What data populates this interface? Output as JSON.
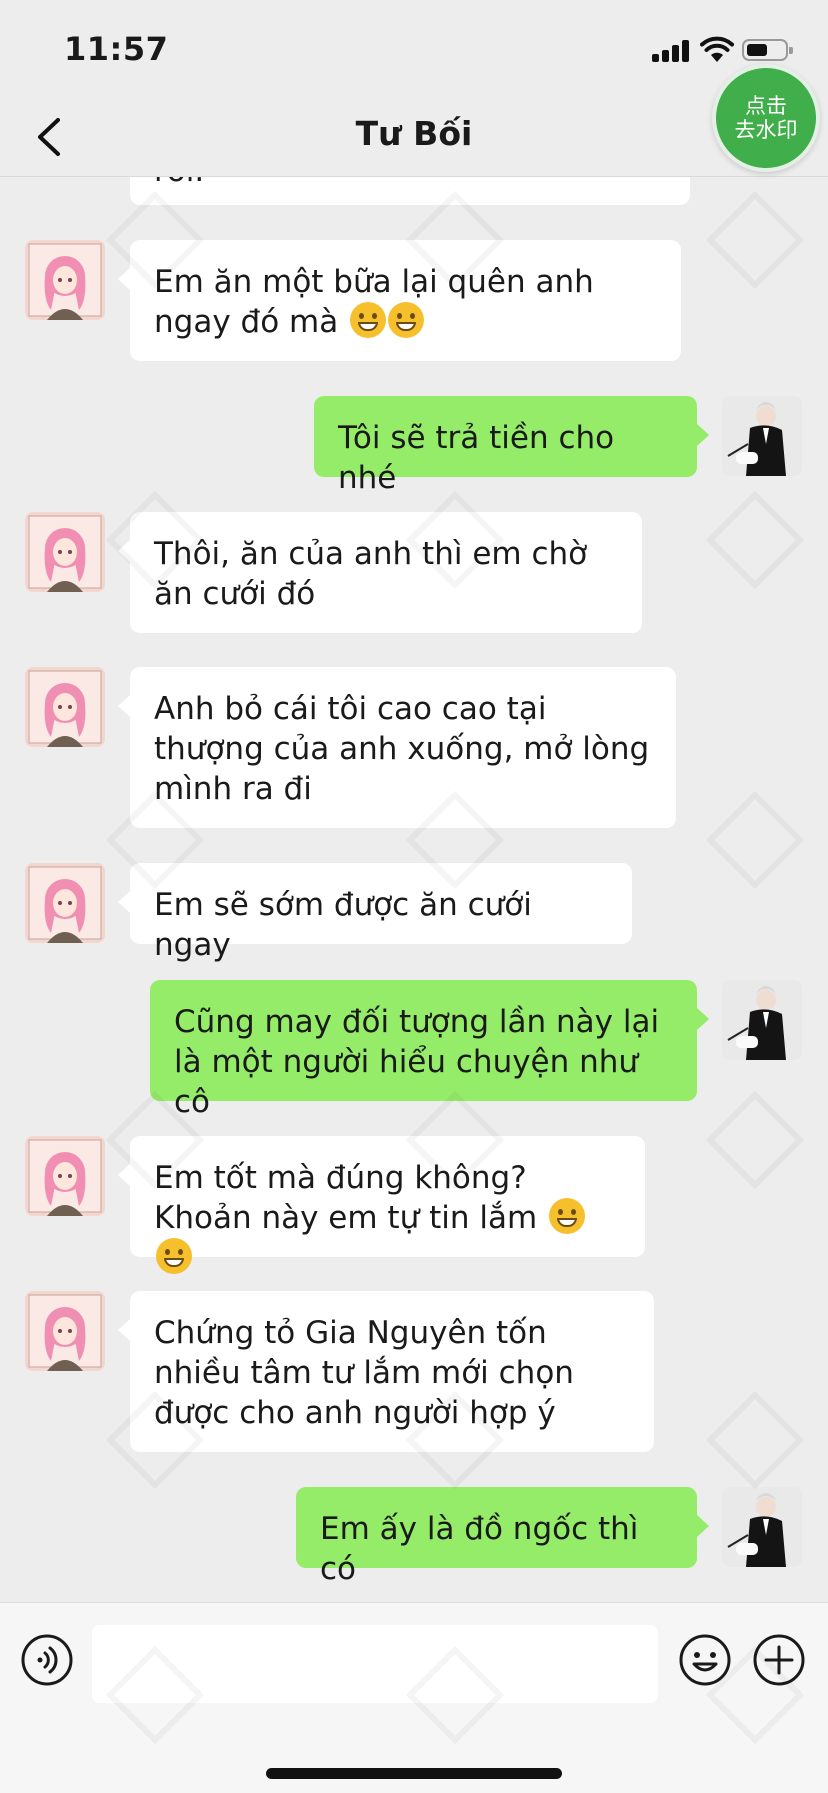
{
  "status_bar": {
    "time": "11:57"
  },
  "header": {
    "title": "Tư Bối",
    "watermark_badge": {
      "line1": "点击",
      "line2": "去水印"
    }
  },
  "messages": [
    {
      "side": "in",
      "text": "rồi."
    },
    {
      "side": "in",
      "text": "Em ăn một bữa lại quên anh ngay đó mà",
      "emoji": "grinning-face-with-smiling-eyes",
      "emoji_count": 2
    },
    {
      "side": "out",
      "text": "Tôi sẽ trả tiền cho nhé"
    },
    {
      "side": "in",
      "text": "Thôi, ăn của anh thì em chờ ăn cưới đó"
    },
    {
      "side": "in",
      "text": "Anh bỏ cái tôi cao cao tại thượng của anh xuống, mở lòng mình ra đi"
    },
    {
      "side": "in",
      "text": "Em sẽ sớm được ăn cưới ngay"
    },
    {
      "side": "out",
      "text": "Cũng may đối tượng lần này lại là một người hiểu chuyện như cô"
    },
    {
      "side": "in",
      "text": "Em tốt mà đúng không? Khoản này em tự tin lắm",
      "emoji": "grinning-face",
      "emoji_count": 2
    },
    {
      "side": "in",
      "text": "Chứng tỏ Gia Nguyên tốn nhiều tâm tư lắm mới chọn được cho anh người hợp ý"
    },
    {
      "side": "out",
      "text": "Em ấy là đồ ngốc thì có"
    }
  ],
  "input_bar": {
    "voice_icon": "voice-icon",
    "emoji_icon": "emoji-icon",
    "more_icon": "plus-icon"
  },
  "colors": {
    "background": "#ededed",
    "bubble_out": "#95ec69",
    "bubble_in": "#ffffff",
    "badge": "#3fae4b"
  }
}
